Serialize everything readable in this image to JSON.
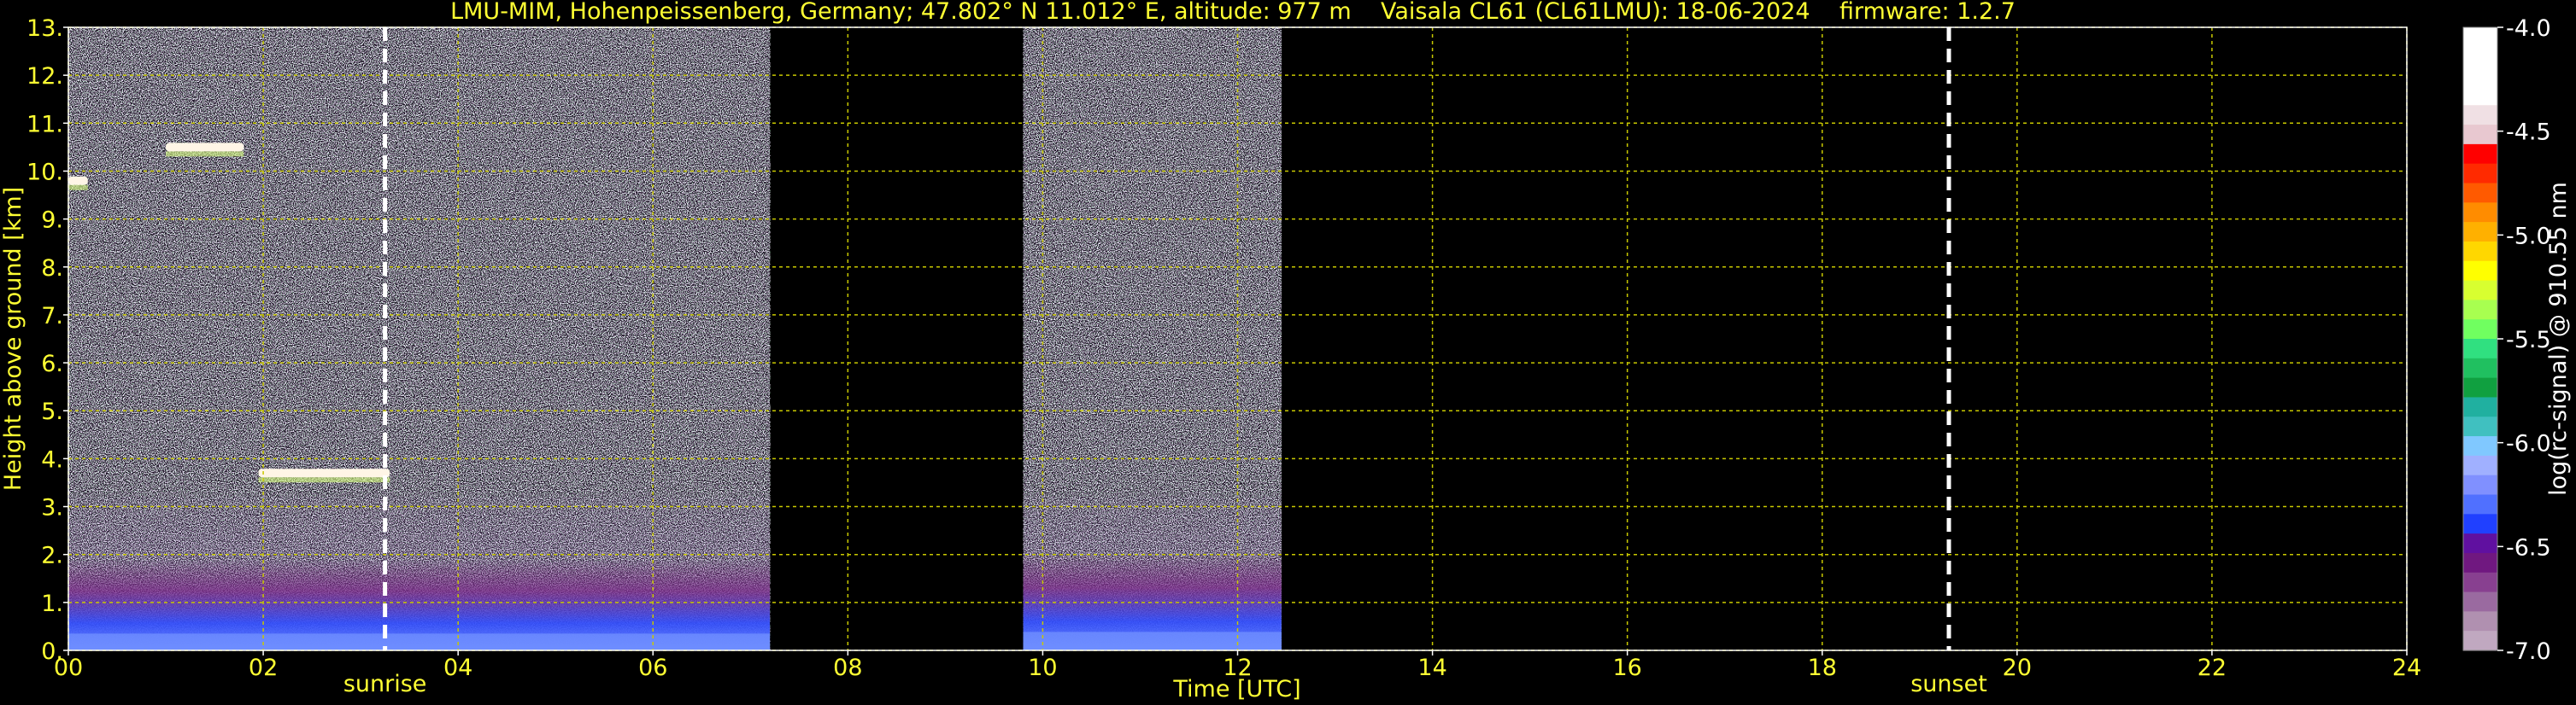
{
  "chart_data": {
    "type": "heatmap",
    "title": "LMU-MIM, Hohenpeissenberg, Germany; 47.802° N 11.012° E, altitude: 977 m    Vaisala CL61 (CL61LMU): 18-06-2024    firmware: 1.2.7",
    "xlabel": "Time [UTC]",
    "ylabel": "Height above ground [km]",
    "xlim": [
      0,
      24
    ],
    "ylim": [
      0,
      13
    ],
    "x_ticks": [
      "00",
      "02",
      "04",
      "06",
      "08",
      "10",
      "12",
      "14",
      "16",
      "18",
      "20",
      "22",
      "24"
    ],
    "x_tick_values": [
      0,
      2,
      4,
      6,
      8,
      10,
      12,
      14,
      16,
      18,
      20,
      22,
      24
    ],
    "y_ticks": [
      "0.",
      "1.",
      "2.",
      "3.",
      "4.",
      "5.",
      "6.",
      "7.",
      "8.",
      "9.",
      "10.",
      "11.",
      "12.",
      "13."
    ],
    "y_tick_values": [
      0,
      1,
      2,
      3,
      4,
      5,
      6,
      7,
      8,
      9,
      10,
      11,
      12,
      13
    ],
    "grid": true,
    "colorbar": {
      "label": "log(rc-signal) @ 910.55 nm",
      "range": [
        -7.0,
        -4.0
      ],
      "ticks": [
        "-4.0",
        "-4.5",
        "-5.0",
        "-5.5",
        "-6.0",
        "-6.5",
        "-7.0"
      ],
      "tick_values": [
        -4.0,
        -4.5,
        -5.0,
        -5.5,
        -6.0,
        -6.5,
        -7.0
      ]
    },
    "annotations": [
      {
        "text": "sunrise",
        "time": 3.25
      },
      {
        "text": "sunset",
        "time": 19.3
      }
    ],
    "data_segments": [
      {
        "start": 0.0,
        "end": 7.2
      },
      {
        "start": 9.8,
        "end": 12.45
      }
    ],
    "cloud_features": [
      {
        "time_start": 1.95,
        "time_end": 3.3,
        "height_km": 3.7
      },
      {
        "time_start": 1.0,
        "time_end": 1.8,
        "height_km": 10.5
      },
      {
        "time_start": 0.0,
        "time_end": 0.2,
        "height_km": 9.8
      }
    ],
    "boundary_layer_top_km": [
      {
        "time_start": 0.0,
        "time_end": 7.2,
        "height_km": 1.0
      },
      {
        "time_start": 9.8,
        "time_end": 12.45,
        "height_km": 1.1
      }
    ]
  }
}
